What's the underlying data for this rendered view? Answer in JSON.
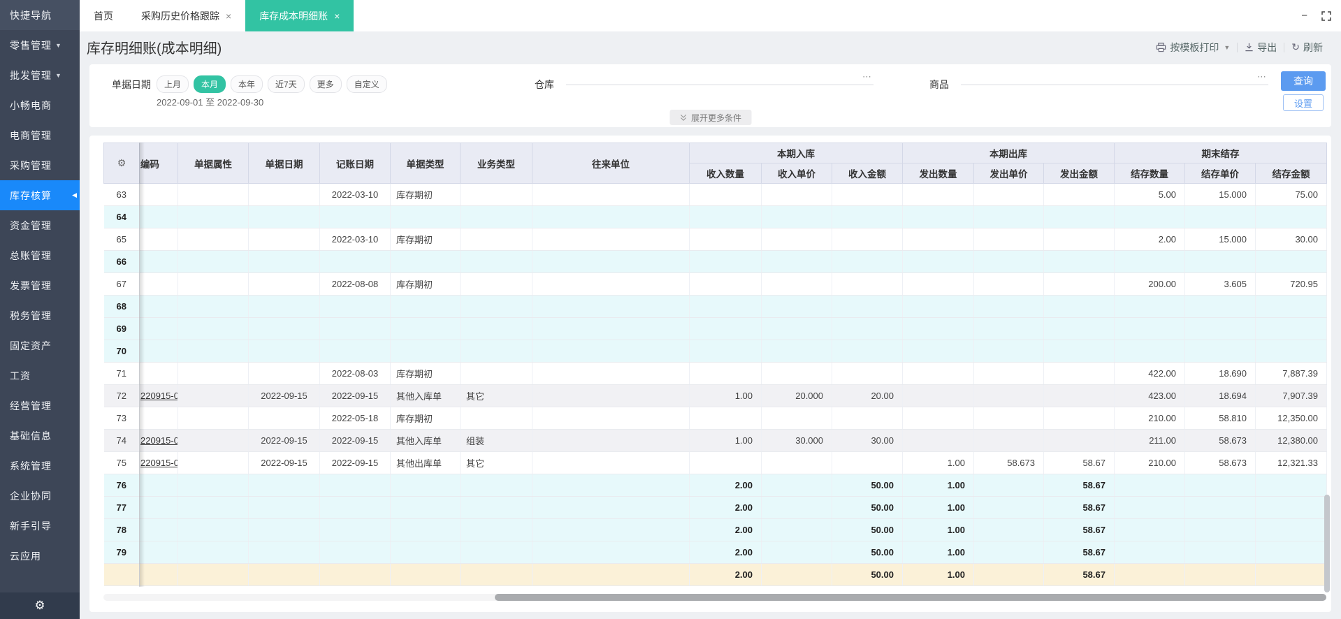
{
  "sidebar": {
    "items": [
      {
        "label": "快捷导航"
      },
      {
        "label": "零售管理",
        "arrow": true
      },
      {
        "label": "批发管理",
        "arrow": true
      },
      {
        "label": "小畅电商"
      },
      {
        "label": "电商管理"
      },
      {
        "label": "采购管理"
      },
      {
        "label": "库存核算",
        "active": true
      },
      {
        "label": "资金管理"
      },
      {
        "label": "总账管理"
      },
      {
        "label": "发票管理"
      },
      {
        "label": "税务管理"
      },
      {
        "label": "固定资产"
      },
      {
        "label": "工资"
      },
      {
        "label": "经营管理"
      },
      {
        "label": "基础信息"
      },
      {
        "label": "系统管理"
      },
      {
        "label": "企业协同"
      },
      {
        "label": "新手引导"
      },
      {
        "label": "云应用"
      }
    ],
    "bottom_icon": "gear"
  },
  "tabs": [
    {
      "label": "首页",
      "closable": false
    },
    {
      "label": "采购历史价格跟踪",
      "closable": true
    },
    {
      "label": "库存成本明细账",
      "closable": true,
      "active": true
    }
  ],
  "page": {
    "title": "库存明细账(成本明细)"
  },
  "toolbar": {
    "print_label": "按模板打印",
    "export_label": "导出",
    "refresh_label": "刷新",
    "refresh_icon_glyph": "↻"
  },
  "filters": {
    "date_label": "单据日期",
    "date_pills": [
      "上月",
      "本月",
      "本年",
      "近7天",
      "更多",
      "自定义"
    ],
    "active_pill": "本月",
    "date_range": "2022-09-01 至 2022-09-30",
    "warehouse_label": "仓库",
    "product_label": "商品",
    "picker_dots": "⋯",
    "query_button": "查询",
    "settings_button": "设置",
    "expand_label": "展开更多条件"
  },
  "table": {
    "groups": {
      "in": "本期入库",
      "out": "本期出库",
      "balance": "期末结存"
    },
    "columns": {
      "code": "编码",
      "attr": "单据属性",
      "doc_date": "单据日期",
      "post_date": "记账日期",
      "doc_type": "单据类型",
      "biz_type": "业务类型",
      "partner": "往来单位",
      "in_qty": "收入数量",
      "in_price": "收入单价",
      "in_amt": "收入金额",
      "out_qty": "发出数量",
      "out_price": "发出单价",
      "out_amt": "发出金额",
      "bal_qty": "结存数量",
      "bal_price": "结存单价",
      "bal_amt": "结存金额"
    },
    "rows": [
      {
        "num": "63",
        "bg": "white",
        "postDate": "2022-03-10",
        "docType": "库存期初",
        "balQty": "5.00",
        "balPrice": "15.000",
        "balAmt": "75.00"
      },
      {
        "num": "64",
        "bg": "cyan",
        "bold": true
      },
      {
        "num": "65",
        "bg": "white",
        "postDate": "2022-03-10",
        "docType": "库存期初",
        "balQty": "2.00",
        "balPrice": "15.000",
        "balAmt": "30.00"
      },
      {
        "num": "66",
        "bg": "cyan",
        "bold": true
      },
      {
        "num": "67",
        "bg": "white",
        "postDate": "2022-08-08",
        "docType": "库存期初",
        "balQty": "200.00",
        "balPrice": "3.605",
        "balAmt": "720.95"
      },
      {
        "num": "68",
        "bg": "cyan",
        "bold": true
      },
      {
        "num": "69",
        "bg": "cyan",
        "bold": true
      },
      {
        "num": "70",
        "bg": "cyan",
        "bold": true
      },
      {
        "num": "71",
        "bg": "white",
        "postDate": "2022-08-03",
        "docType": "库存期初",
        "balQty": "422.00",
        "balPrice": "18.690",
        "balAmt": "7,887.39"
      },
      {
        "num": "72",
        "bg": "gray",
        "code": "220915-0",
        "docDate": "2022-09-15",
        "postDate": "2022-09-15",
        "docType": "其他入库单",
        "bizType": "其它",
        "inQty": "1.00",
        "inPrice": "20.000",
        "inAmt": "20.00",
        "balQty": "423.00",
        "balPrice": "18.694",
        "balAmt": "7,907.39"
      },
      {
        "num": "73",
        "bg": "white",
        "postDate": "2022-05-18",
        "docType": "库存期初",
        "balQty": "210.00",
        "balPrice": "58.810",
        "balAmt": "12,350.00"
      },
      {
        "num": "74",
        "bg": "gray",
        "code": "220915-0",
        "docDate": "2022-09-15",
        "postDate": "2022-09-15",
        "docType": "其他入库单",
        "bizType": "组装",
        "inQty": "1.00",
        "inPrice": "30.000",
        "inAmt": "30.00",
        "balQty": "211.00",
        "balPrice": "58.673",
        "balAmt": "12,380.00"
      },
      {
        "num": "75",
        "bg": "white",
        "code": "220915-0",
        "docDate": "2022-09-15",
        "postDate": "2022-09-15",
        "docType": "其他出库单",
        "bizType": "其它",
        "outQty": "1.00",
        "outPrice": "58.673",
        "outAmt": "58.67",
        "balQty": "210.00",
        "balPrice": "58.673",
        "balAmt": "12,321.33"
      },
      {
        "num": "76",
        "bg": "cyan",
        "bold": true,
        "inQty": "2.00",
        "inAmt": "50.00",
        "outQty": "1.00",
        "outAmt": "58.67"
      },
      {
        "num": "77",
        "bg": "cyan",
        "bold": true,
        "inQty": "2.00",
        "inAmt": "50.00",
        "outQty": "1.00",
        "outAmt": "58.67"
      },
      {
        "num": "78",
        "bg": "cyan",
        "bold": true,
        "inQty": "2.00",
        "inAmt": "50.00",
        "outQty": "1.00",
        "outAmt": "58.67"
      },
      {
        "num": "79",
        "bg": "cyan",
        "bold": true,
        "inQty": "2.00",
        "inAmt": "50.00",
        "outQty": "1.00",
        "outAmt": "58.67"
      }
    ],
    "footer": {
      "bg": "yellow",
      "bold": true,
      "inQty": "2.00",
      "inAmt": "50.00",
      "outQty": "1.00",
      "outAmt": "58.67"
    }
  },
  "colors": {
    "sidebar_bg": "#3d4657",
    "sidebar_active": "#1989fa",
    "tab_active": "#32c3a3",
    "pill_active": "#32c3a3",
    "query_button": "#5c9bf0",
    "header_bg": "#e9ebf4",
    "row_summary": "#e7f9fb",
    "row_stripe": "#f1f1f4",
    "row_footer": "#fbf1d8"
  }
}
